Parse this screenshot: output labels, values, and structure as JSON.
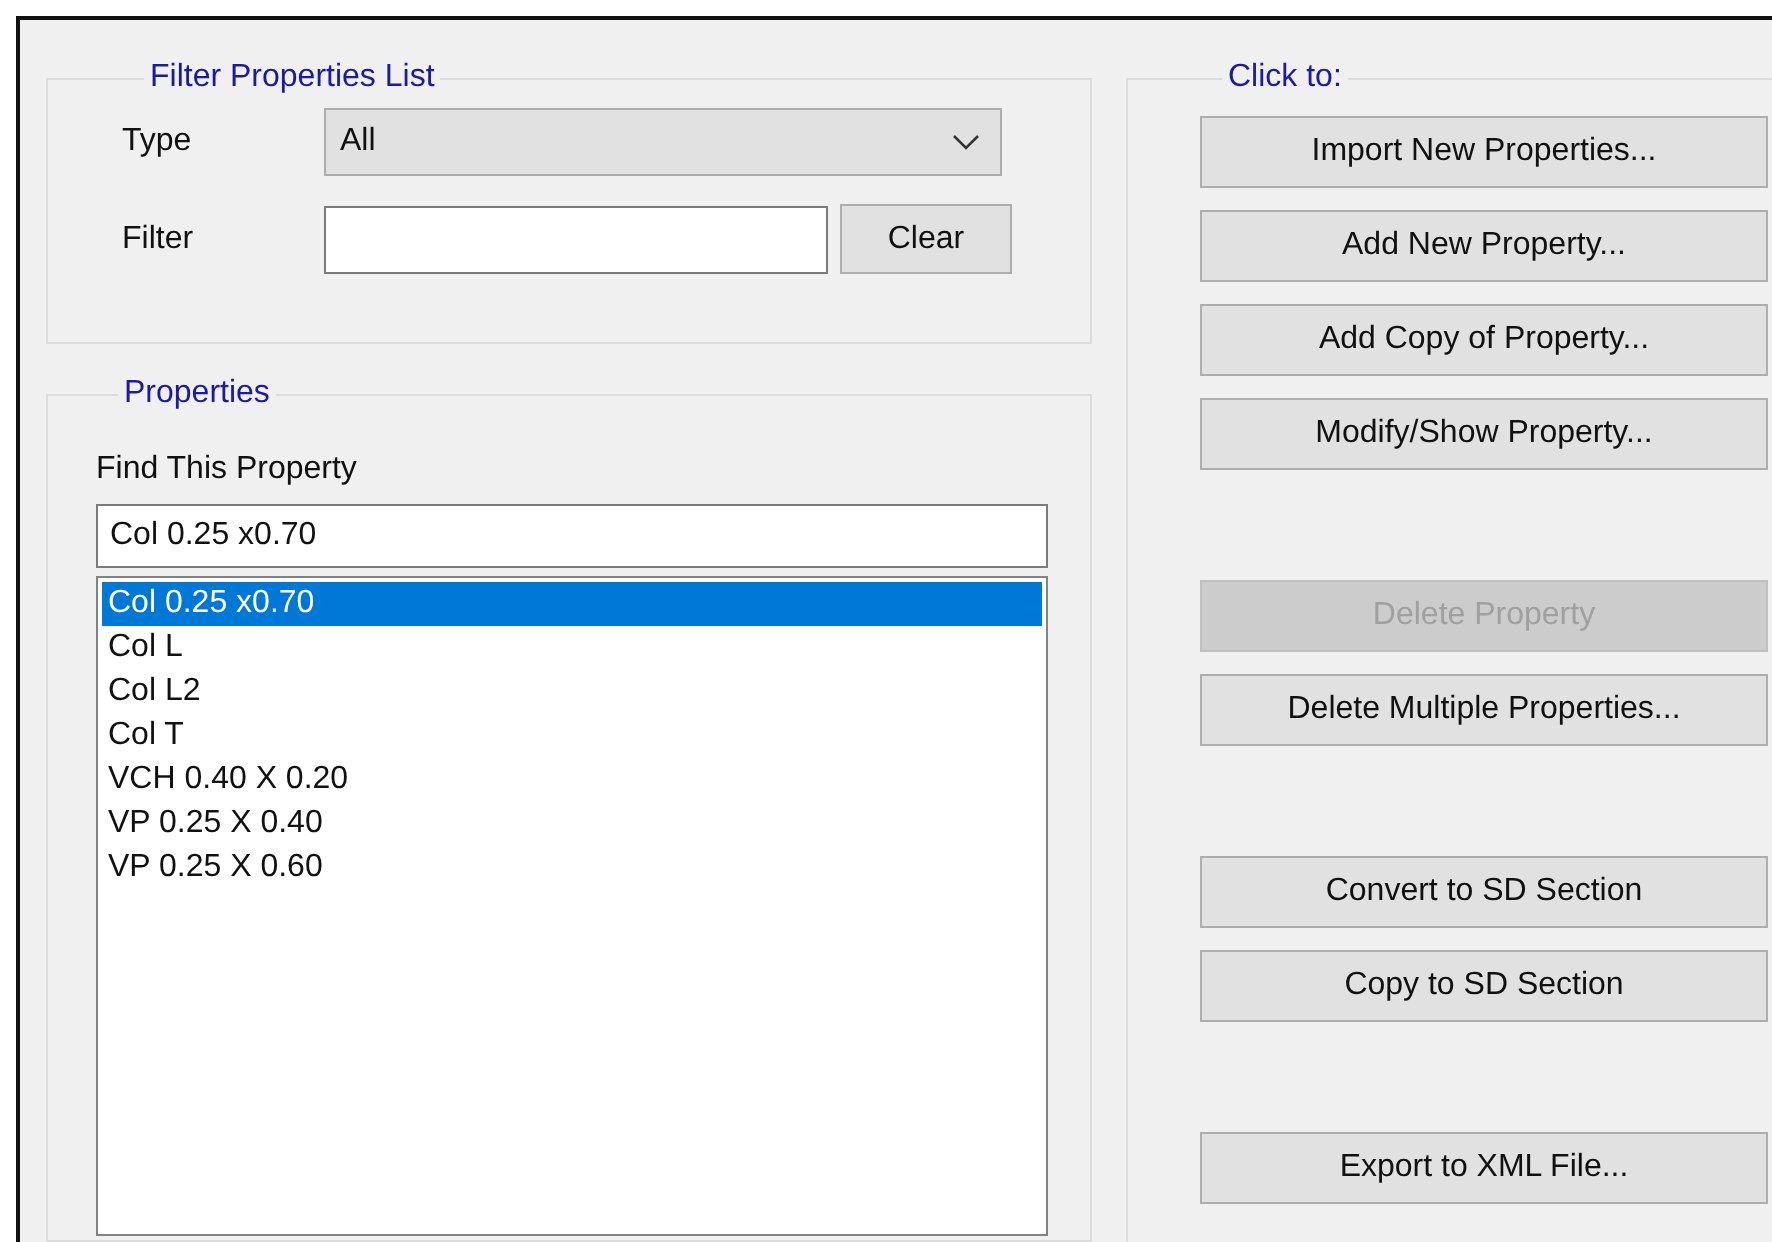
{
  "filter_group": {
    "title": "Filter Properties List",
    "type_label": "Type",
    "type_value": "All",
    "filter_label": "Filter",
    "clear_button": "Clear"
  },
  "properties_group": {
    "title": "Properties",
    "find_label": "Find This Property",
    "find_value": "Col 0.25 x0.70",
    "items": [
      {
        "label": "Col 0.25 x0.70",
        "selected": true
      },
      {
        "label": "Col L",
        "selected": false
      },
      {
        "label": "Col L2",
        "selected": false
      },
      {
        "label": "Col T",
        "selected": false
      },
      {
        "label": "VCH 0.40 X 0.20",
        "selected": false
      },
      {
        "label": "VP 0.25 X 0.40",
        "selected": false
      },
      {
        "label": "VP 0.25 X 0.60",
        "selected": false
      }
    ]
  },
  "actions_group": {
    "title": "Click to:",
    "button_groups": [
      [
        {
          "label": "Import New Properties...",
          "disabled": false
        },
        {
          "label": "Add New Property...",
          "disabled": false
        },
        {
          "label": "Add Copy of Property...",
          "disabled": false
        },
        {
          "label": "Modify/Show Property...",
          "disabled": false
        }
      ],
      [
        {
          "label": "Delete Property",
          "disabled": true
        },
        {
          "label": "Delete Multiple Properties...",
          "disabled": false
        }
      ],
      [
        {
          "label": "Convert to SD Section",
          "disabled": false
        },
        {
          "label": "Copy to SD Section",
          "disabled": false
        }
      ],
      [
        {
          "label": "Export to XML File...",
          "disabled": false
        }
      ]
    ]
  }
}
